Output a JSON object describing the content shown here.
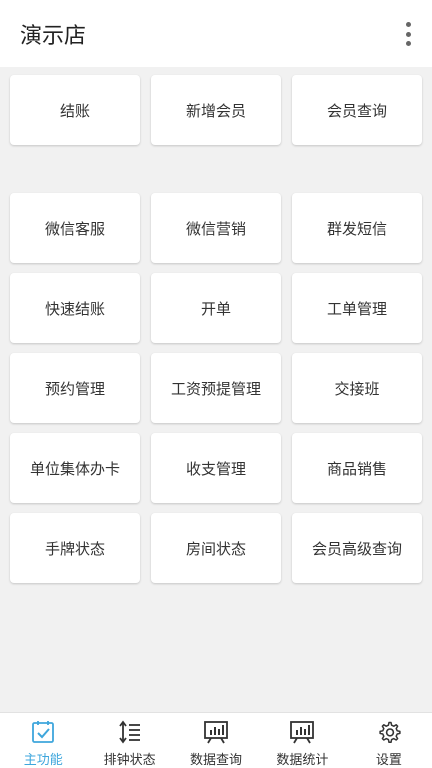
{
  "app_bar": {
    "title": "演示店",
    "more_icon": "more-vertical-icon"
  },
  "grid": {
    "top_row": [
      "结账",
      "新增会员",
      "会员查询"
    ],
    "rows": [
      [
        "微信客服",
        "微信营销",
        "群发短信"
      ],
      [
        "快速结账",
        "开单",
        "工单管理"
      ],
      [
        "预约管理",
        "工资预提管理",
        "交接班"
      ],
      [
        "单位集体办卡",
        "收支管理",
        "商品销售"
      ],
      [
        "手牌状态",
        "房间状态",
        "会员高级查询"
      ]
    ]
  },
  "bottom_nav": {
    "accent_color": "#3ea6dc",
    "items": [
      {
        "label": "主功能",
        "icon": "checklist-icon",
        "active": true
      },
      {
        "label": "排钟状态",
        "icon": "sort-list-icon",
        "active": false
      },
      {
        "label": "数据查询",
        "icon": "chart-monitor-icon",
        "active": false
      },
      {
        "label": "数据统计",
        "icon": "chart-monitor-icon",
        "active": false
      },
      {
        "label": "设置",
        "icon": "gear-icon",
        "active": false
      }
    ]
  }
}
